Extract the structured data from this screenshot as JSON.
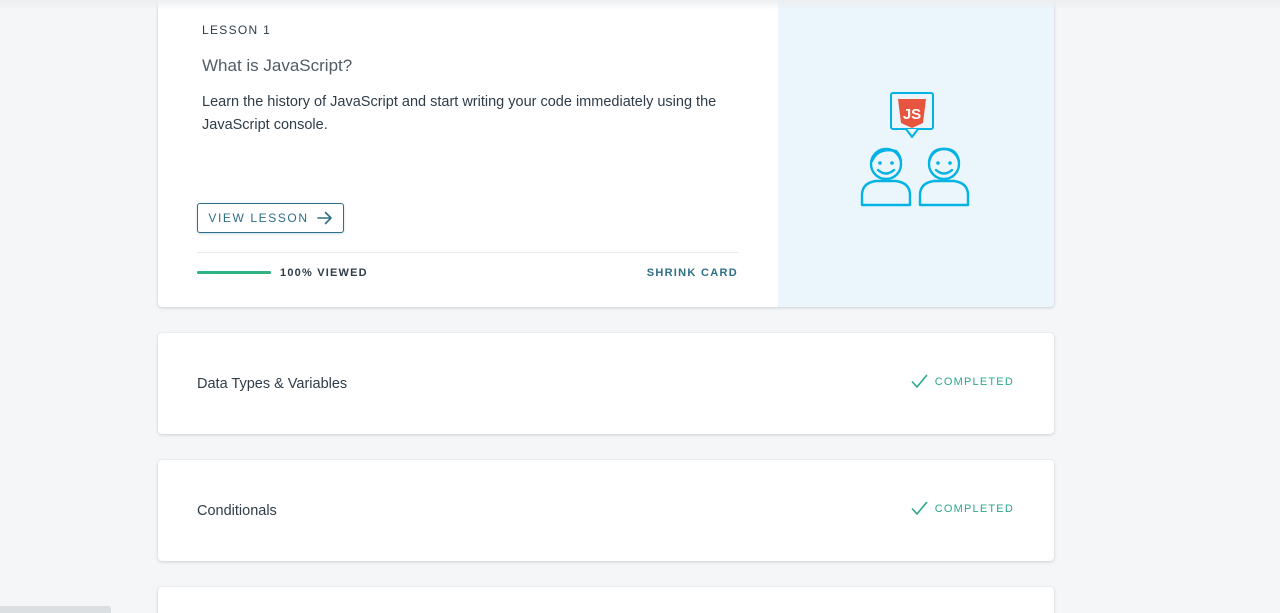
{
  "lesson": {
    "label": "LESSON 1",
    "title": "What is JavaScript?",
    "description": "Learn the history of JavaScript and start writing your code immediately using the JavaScript console.",
    "view_button": "VIEW LESSON",
    "progress_percent": 100,
    "progress_text": "100% VIEWED",
    "shrink_label": "SHRINK CARD",
    "illustration_badge": "JS",
    "illustration_icon": "two-people-js-chat-icon"
  },
  "lessons": [
    {
      "title": "Data Types & Variables",
      "status": "COMPLETED"
    },
    {
      "title": "Conditionals",
      "status": "COMPLETED"
    }
  ],
  "colors": {
    "accent": "#2e6e86",
    "progress": "#2fb380",
    "completed": "#2aa88c",
    "illustration_bg": "#eaf6fb",
    "illustration_line": "#02b3e4",
    "badge": "#e8553e"
  }
}
